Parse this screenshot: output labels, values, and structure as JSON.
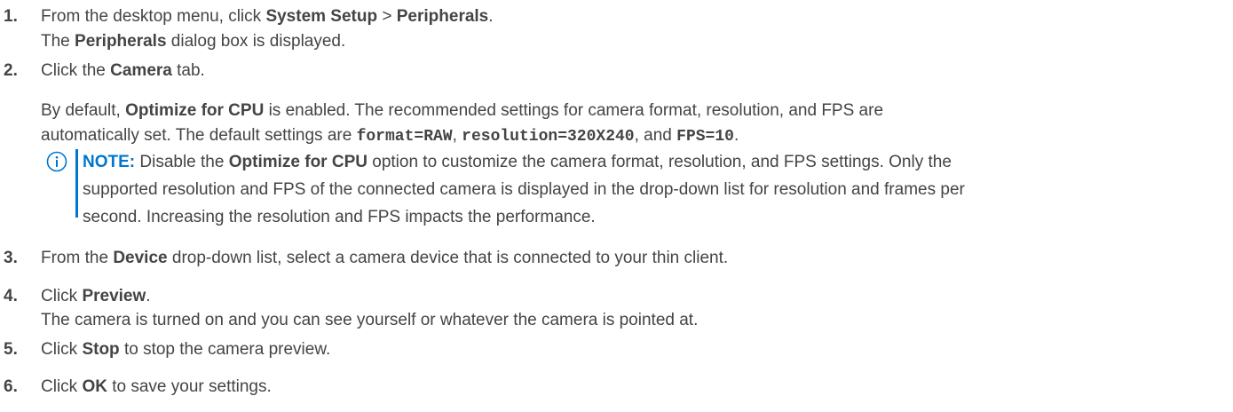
{
  "steps": [
    {
      "num": "1.",
      "lines": [
        {
          "t1": "From the desktop menu, click ",
          "b1": "System Setup",
          "t2": " > ",
          "b2": "Peripherals",
          "t3": "."
        },
        {
          "t1": "The ",
          "b1": "Peripherals",
          "t2": " dialog box is displayed."
        }
      ]
    },
    {
      "num": "2.",
      "lines": [
        {
          "t1": "Click the ",
          "b1": "Camera",
          "t2": " tab."
        },
        {
          "t1": "By default, ",
          "b1": "Optimize for CPU",
          "t2": " is enabled. The recommended settings for camera format, resolution, and FPS are"
        },
        {
          "t1": "automatically set. The default settings are ",
          "m1": "format=RAW",
          "t2": ", ",
          "m2": "resolution=320X240",
          "t3": ", and ",
          "m3": "FPS=10",
          "t4": "."
        }
      ],
      "note": {
        "label": "NOTE:",
        "t1": " Disable the ",
        "b1": "Optimize for CPU",
        "t2": " option to customize the camera format, resolution, and FPS settings. Only the",
        "line2": "supported resolution and FPS of the connected camera is displayed in the drop-down list for resolution and frames per",
        "line3": "second. Increasing the resolution and FPS impacts the performance."
      }
    },
    {
      "num": "3.",
      "lines": [
        {
          "t1": "From the ",
          "b1": "Device",
          "t2": " drop-down list, select a camera device that is connected to your thin client."
        }
      ]
    },
    {
      "num": "4.",
      "lines": [
        {
          "t1": "Click ",
          "b1": "Preview",
          "t2": "."
        },
        {
          "t1": "The camera is turned on and you can see yourself or whatever the camera is pointed at."
        }
      ]
    },
    {
      "num": "5.",
      "lines": [
        {
          "t1": "Click ",
          "b1": "Stop",
          "t2": " to stop the camera preview."
        }
      ]
    },
    {
      "num": "6.",
      "lines": [
        {
          "t1": "Click ",
          "b1": "OK",
          "t2": " to save your settings."
        }
      ]
    }
  ],
  "colors": {
    "text": "#444444",
    "accent": "#0076ce"
  },
  "icons": {
    "note": "info-circle-icon"
  }
}
